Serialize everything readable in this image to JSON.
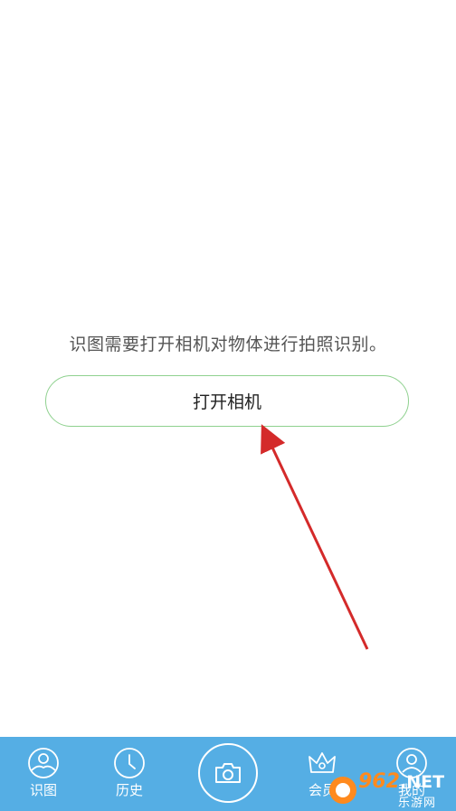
{
  "main": {
    "message": "识图需要打开相机对物体进行拍照识别。",
    "open_camera_label": "打开相机"
  },
  "tabbar": {
    "background": "#55aee4",
    "tabs": [
      {
        "label": "识图",
        "icon": "photo-recognize-icon"
      },
      {
        "label": "历史",
        "icon": "clock-icon"
      },
      {
        "label": "会员",
        "icon": "crown-icon"
      },
      {
        "label": "我的",
        "icon": "user-icon"
      }
    ],
    "center_icon": "camera-icon"
  },
  "watermark": {
    "number": "962",
    "suffix": ".NET",
    "sub": "乐游网"
  },
  "annotation": {
    "arrow_color": "#d42a2a"
  }
}
